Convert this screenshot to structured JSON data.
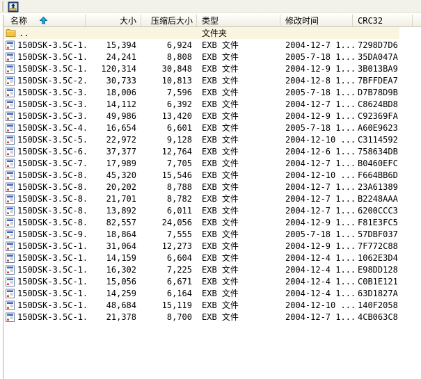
{
  "toolbar": {
    "up_button": {
      "icon": "folder-up-icon",
      "tooltip": ""
    }
  },
  "header": {
    "sort": {
      "column": "name",
      "direction": "ascending",
      "icon": "sort-ascending-icon"
    },
    "columns": [
      {
        "id": "name",
        "label": "名称",
        "align": "left"
      },
      {
        "id": "size",
        "label": "大小",
        "align": "right"
      },
      {
        "id": "packed",
        "label": "压缩后大小",
        "align": "right"
      },
      {
        "id": "type",
        "label": "类型",
        "align": "left"
      },
      {
        "id": "mtime",
        "label": "修改时间",
        "align": "left"
      },
      {
        "id": "crc",
        "label": "CRC32",
        "align": "left"
      }
    ]
  },
  "list": {
    "folder_row": {
      "icon": "folder-icon",
      "name": "..",
      "type": "文件夹"
    },
    "file_icon": "exb-file-icon",
    "rows": [
      {
        "name": "150DSK-3.5C-1...",
        "size": "15,394",
        "packed": "6,924",
        "type": "EXB 文件",
        "mtime": "2004-12-7 1...",
        "crc": "7298D7D6"
      },
      {
        "name": "150DSK-3.5C-1...",
        "size": "24,241",
        "packed": "8,808",
        "type": "EXB 文件",
        "mtime": "2005-7-18 1...",
        "crc": "35DA047A"
      },
      {
        "name": "150DSK-3.5C-1...",
        "size": "120,314",
        "packed": "30,848",
        "type": "EXB 文件",
        "mtime": "2004-12-9 1...",
        "crc": "3B013BA9"
      },
      {
        "name": "150DSK-3.5C-2...",
        "size": "30,733",
        "packed": "10,813",
        "type": "EXB 文件",
        "mtime": "2004-12-8 1...",
        "crc": "7BFFDEA7"
      },
      {
        "name": "150DSK-3.5C-3...",
        "size": "18,006",
        "packed": "7,596",
        "type": "EXB 文件",
        "mtime": "2005-7-18 1...",
        "crc": "D7B78D9B"
      },
      {
        "name": "150DSK-3.5C-3...",
        "size": "14,112",
        "packed": "6,392",
        "type": "EXB 文件",
        "mtime": "2004-12-7 1...",
        "crc": "C8624BD8"
      },
      {
        "name": "150DSK-3.5C-3...",
        "size": "49,986",
        "packed": "13,420",
        "type": "EXB 文件",
        "mtime": "2004-12-9 1...",
        "crc": "C92369FA"
      },
      {
        "name": "150DSK-3.5C-4...",
        "size": "16,654",
        "packed": "6,601",
        "type": "EXB 文件",
        "mtime": "2005-7-18 1...",
        "crc": "A60E9623"
      },
      {
        "name": "150DSK-3.5C-5...",
        "size": "22,972",
        "packed": "9,128",
        "type": "EXB 文件",
        "mtime": "2004-12-10 ...",
        "crc": "C3114592"
      },
      {
        "name": "150DSK-3.5C-6...",
        "size": "37,377",
        "packed": "12,764",
        "type": "EXB 文件",
        "mtime": "2004-12-6 1...",
        "crc": "758634DB"
      },
      {
        "name": "150DSK-3.5C-7...",
        "size": "17,989",
        "packed": "7,705",
        "type": "EXB 文件",
        "mtime": "2004-12-7 1...",
        "crc": "B0460EFC"
      },
      {
        "name": "150DSK-3.5C-8...",
        "size": "45,320",
        "packed": "15,546",
        "type": "EXB 文件",
        "mtime": "2004-12-10 ...",
        "crc": "F664BB6D"
      },
      {
        "name": "150DSK-3.5C-8...",
        "size": "20,202",
        "packed": "8,788",
        "type": "EXB 文件",
        "mtime": "2004-12-7 1...",
        "crc": "23A61389"
      },
      {
        "name": "150DSK-3.5C-8...",
        "size": "21,701",
        "packed": "8,782",
        "type": "EXB 文件",
        "mtime": "2004-12-7 1...",
        "crc": "B2248AAA"
      },
      {
        "name": "150DSK-3.5C-8...",
        "size": "13,892",
        "packed": "6,011",
        "type": "EXB 文件",
        "mtime": "2004-12-7 1...",
        "crc": "6200CCC3"
      },
      {
        "name": "150DSK-3.5C-8...",
        "size": "82,557",
        "packed": "24,056",
        "type": "EXB 文件",
        "mtime": "2004-12-9 1...",
        "crc": "F81E3FC5"
      },
      {
        "name": "150DSK-3.5C-9...",
        "size": "18,864",
        "packed": "7,555",
        "type": "EXB 文件",
        "mtime": "2005-7-18 1...",
        "crc": "57DBF037"
      },
      {
        "name": "150DSK-3.5C-1...",
        "size": "31,064",
        "packed": "12,273",
        "type": "EXB 文件",
        "mtime": "2004-12-9 1...",
        "crc": "7F772C88"
      },
      {
        "name": "150DSK-3.5C-1...",
        "size": "14,159",
        "packed": "6,604",
        "type": "EXB 文件",
        "mtime": "2004-12-4 1...",
        "crc": "1062E3D4"
      },
      {
        "name": "150DSK-3.5C-1...",
        "size": "16,302",
        "packed": "7,225",
        "type": "EXB 文件",
        "mtime": "2004-12-4 1...",
        "crc": "E98DD128"
      },
      {
        "name": "150DSK-3.5C-1...",
        "size": "15,056",
        "packed": "6,671",
        "type": "EXB 文件",
        "mtime": "2004-12-4 1...",
        "crc": "C0B1E121"
      },
      {
        "name": "150DSK-3.5C-1...",
        "size": "14,259",
        "packed": "6,164",
        "type": "EXB 文件",
        "mtime": "2004-12-4 1...",
        "crc": "63D1827A"
      },
      {
        "name": "150DSK-3.5C-1...",
        "size": "48,684",
        "packed": "15,119",
        "type": "EXB 文件",
        "mtime": "2004-12-10 ...",
        "crc": "140F2058"
      },
      {
        "name": "150DSK-3.5C-1...",
        "size": "21,378",
        "packed": "8,700",
        "type": "EXB 文件",
        "mtime": "2004-12-7 1...",
        "crc": "4CB063C8"
      }
    ]
  },
  "colors": {
    "toolbar_bg": "#f2f1ea",
    "header_gradient_top": "#fefefb",
    "header_gradient_bottom": "#f1efe2",
    "header_separator": "#d9d5c6",
    "folder_row_bg": "#faf5e1",
    "sort_arrow": "#29a8e0",
    "folder_icon": "#f2c545",
    "panel_border": "#b5b1a4"
  }
}
